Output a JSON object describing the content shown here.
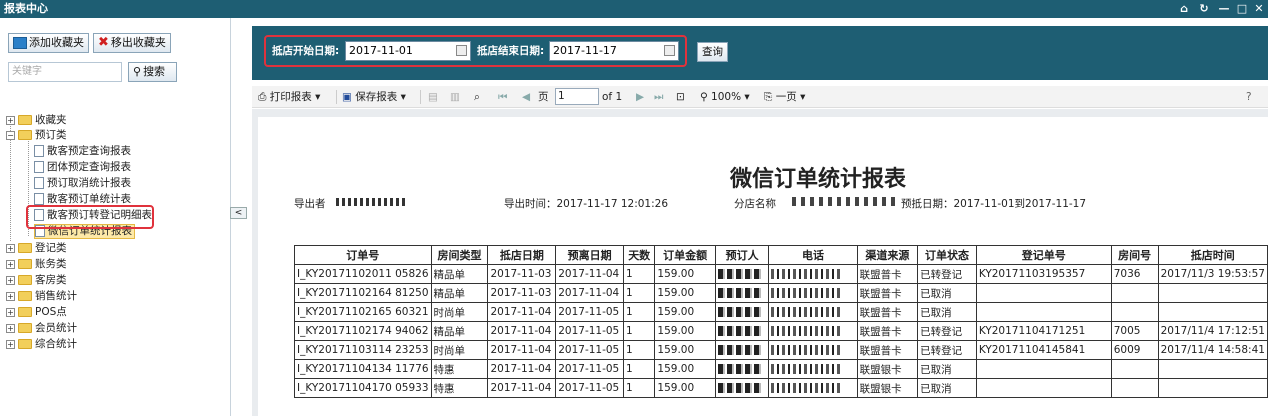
{
  "app": {
    "title": "报表中心"
  },
  "left": {
    "add_fav": "添加收藏夹",
    "remove_fav": "移出收藏夹",
    "keyword_placeholder": "关键字",
    "search": "搜索",
    "collapse": "<"
  },
  "tree": {
    "favorites": "收藏夹",
    "booking": "预订类",
    "booking_items": [
      "散客预定查询报表",
      "团体预定查询报表",
      "预订取消统计报表",
      "散客预订单统计表",
      "散客预订转登记明细表",
      "微信订单统计报表"
    ],
    "others": [
      "登记类",
      "账务类",
      "客房类",
      "销售统计",
      "POS点",
      "会员统计",
      "综合统计"
    ]
  },
  "filter": {
    "start_label": "抵店开始日期:",
    "start_value": "2017-11-01",
    "end_label": "抵店结束日期:",
    "end_value": "2017-11-17",
    "query": "查询"
  },
  "toolbar": {
    "print": "打印报表",
    "save": "保存报表",
    "page_label": "页",
    "page_value": "1",
    "page_of": "of 1",
    "zoom": "100%",
    "view": "一页",
    "help": "?"
  },
  "report": {
    "title": "微信订单统计报表",
    "exporter": "导出者",
    "export_time": "导出时间：2017-11-17 12:01:26",
    "branch": "分店名称",
    "arrival": "预抵日期：2017-11-01到2017-11-17",
    "columns": [
      "订单号",
      "房间类型",
      "抵店日期",
      "预离日期",
      "天数",
      "订单金额",
      "预订人",
      "电话",
      "渠道来源",
      "订单状态",
      "登记单号",
      "房间号",
      "抵店时间"
    ],
    "rows": [
      [
        "I_KY20171102011 05826",
        "精品单",
        "2017-11-03",
        "2017-11-04",
        "1",
        "159.00",
        "",
        "",
        "联盟普卡",
        "已转登记",
        "KY20171103195357",
        "7036",
        "2017/11/3 19:53:57"
      ],
      [
        "I_KY20171102164 81250",
        "精品单",
        "2017-11-03",
        "2017-11-04",
        "1",
        "159.00",
        "",
        "",
        "联盟普卡",
        "已取消",
        "",
        "",
        ""
      ],
      [
        "I_KY20171102165 60321",
        "时尚单",
        "2017-11-04",
        "2017-11-05",
        "1",
        "159.00",
        "",
        "",
        "联盟普卡",
        "已取消",
        "",
        "",
        ""
      ],
      [
        "I_KY20171102174 94062",
        "精品单",
        "2017-11-04",
        "2017-11-05",
        "1",
        "159.00",
        "",
        "",
        "联盟普卡",
        "已转登记",
        "KY20171104171251",
        "7005",
        "2017/11/4 17:12:51"
      ],
      [
        "I_KY20171103114 23253",
        "时尚单",
        "2017-11-04",
        "2017-11-05",
        "1",
        "159.00",
        "",
        "",
        "联盟普卡",
        "已转登记",
        "KY20171104145841",
        "6009",
        "2017/11/4 14:58:41"
      ],
      [
        "I_KY20171104134 11776",
        "特惠",
        "2017-11-04",
        "2017-11-05",
        "1",
        "159.00",
        "",
        "",
        "联盟银卡",
        "已取消",
        "",
        "",
        ""
      ],
      [
        "I_KY20171104170 05933",
        "特惠",
        "2017-11-04",
        "2017-11-05",
        "1",
        "159.00",
        "",
        "",
        "联盟银卡",
        "已取消",
        "",
        "",
        ""
      ]
    ]
  }
}
